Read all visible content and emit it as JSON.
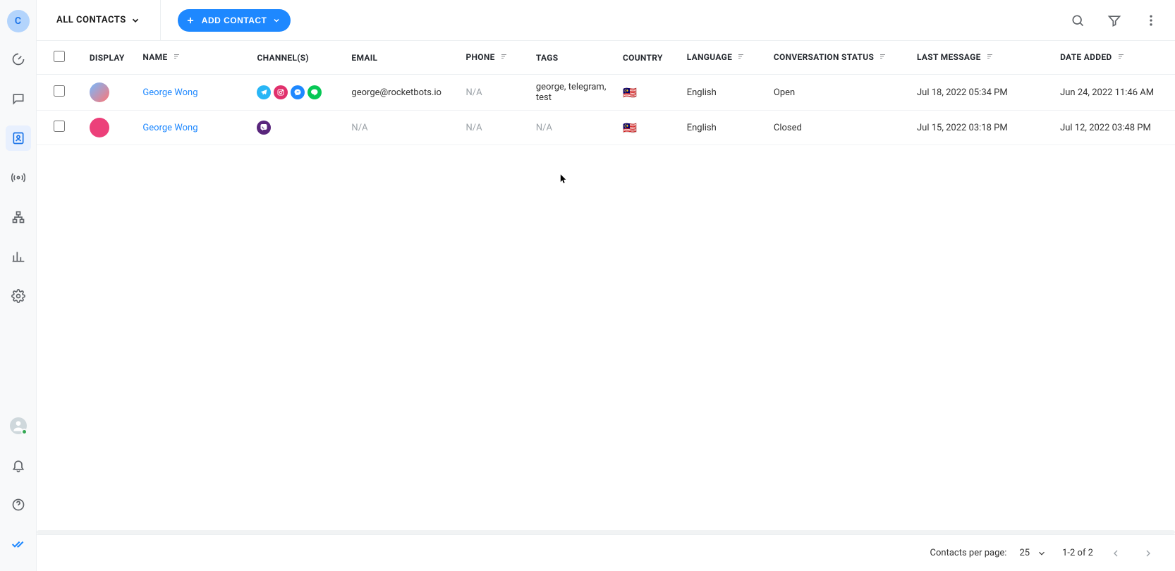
{
  "workspace_initial": "C",
  "header": {
    "segment_label": "ALL CONTACTS",
    "add_contact_label": "ADD CONTACT"
  },
  "columns": {
    "display": "DISPLAY",
    "name": "NAME",
    "channels": "CHANNEL(S)",
    "email": "EMAIL",
    "phone": "PHONE",
    "tags": "TAGS",
    "country": "COUNTRY",
    "language": "LANGUAGE",
    "status": "CONVERSATION STATUS",
    "last_message": "LAST MESSAGE",
    "date_added": "DATE ADDED"
  },
  "rows": [
    {
      "avatar_bg": "linear-gradient(135deg,#74b9ff,#ff7675)",
      "name": "George Wong",
      "channels": [
        "telegram",
        "instagram",
        "messenger",
        "line"
      ],
      "email": "george@rocketbots.io",
      "phone": "N/A",
      "tags": "george, telegram, test",
      "country_flag": "🇲🇾",
      "language": "English",
      "status": "Open",
      "last_message": "Jul 18, 2022 05:34 PM",
      "date_added": "Jun 24, 2022 11:46 AM"
    },
    {
      "avatar_bg": "#ec407a",
      "name": "George Wong",
      "channels": [
        "viber"
      ],
      "email": "N/A",
      "phone": "N/A",
      "tags": "N/A",
      "country_flag": "🇲🇾",
      "language": "English",
      "status": "Closed",
      "last_message": "Jul 15, 2022 03:18 PM",
      "date_added": "Jul 12, 2022 03:48 PM"
    }
  ],
  "footer": {
    "per_page_label": "Contacts per page:",
    "per_page_value": "25",
    "range_text": "1-2 of 2"
  },
  "channel_colors": {
    "telegram": "#29b6f6",
    "instagram": "#e1306c",
    "messenger": "#1e88ff",
    "line": "#06c755",
    "viber": "#59267c"
  }
}
